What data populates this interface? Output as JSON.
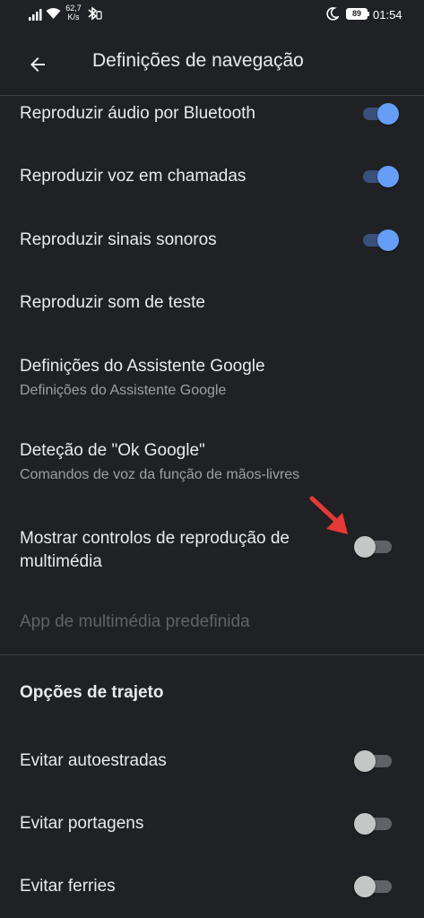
{
  "status_bar": {
    "speed_value": "62,7",
    "speed_unit": "K/s",
    "battery_level": "89",
    "time": "01:54",
    "icons": [
      "signal-icon",
      "wifi-icon",
      "bluetooth-icon",
      "moon-icon",
      "battery-icon"
    ]
  },
  "app_bar": {
    "back_icon": "arrow-left-icon",
    "title": "Definições de navegação"
  },
  "settings": [
    {
      "title": "Reproduzir áudio por Bluetooth",
      "toggle": true
    },
    {
      "title": "Reproduzir voz em chamadas",
      "toggle": true
    },
    {
      "title": "Reproduzir sinais sonoros",
      "toggle": true
    },
    {
      "title": "Reproduzir som de teste"
    },
    {
      "title": "Definições do Assistente Google",
      "subtitle": "Definições do Assistente Google"
    },
    {
      "title": "Deteção de \"Ok Google\"",
      "subtitle": "Comandos de voz da função de mãos-livres"
    },
    {
      "title": "Mostrar controlos de reprodução de multimédia",
      "toggle": false
    },
    {
      "title": "App de multimédia predefinida",
      "disabled": true
    }
  ],
  "route_options": {
    "header": "Opções de trajeto",
    "items": [
      {
        "title": "Evitar autoestradas",
        "toggle": false
      },
      {
        "title": "Evitar portagens",
        "toggle": false
      },
      {
        "title": "Evitar ferries",
        "toggle": false
      }
    ]
  },
  "colors": {
    "background": "#202124",
    "accent": "#669df6",
    "annotation_arrow": "#e53935"
  }
}
